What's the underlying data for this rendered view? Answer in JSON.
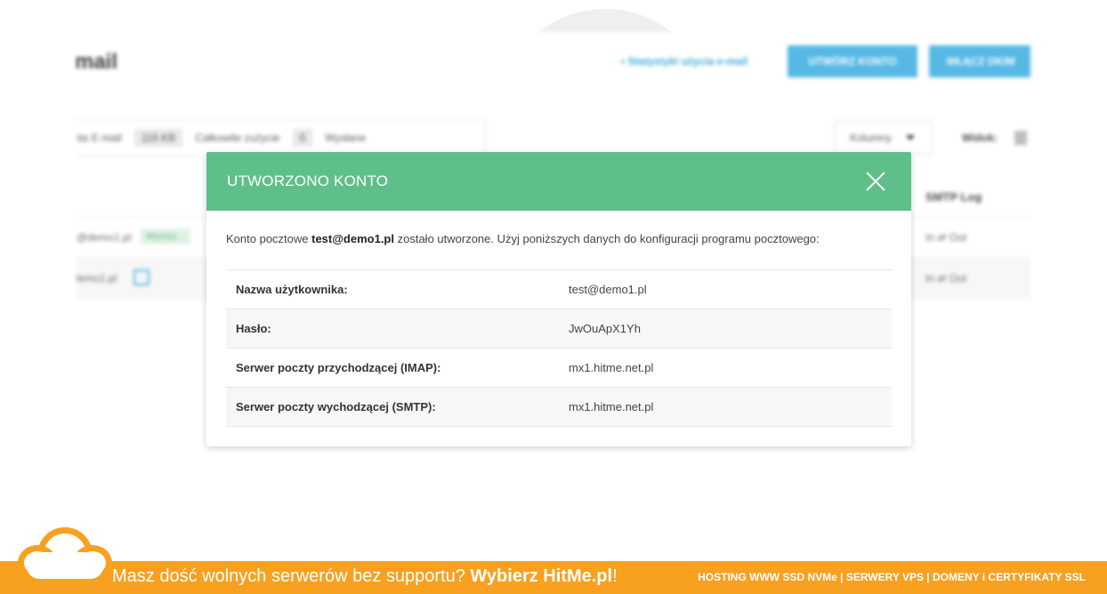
{
  "background_app": {
    "page_title": "-mail",
    "stats_link": "• Statystyki użycia e-mail",
    "create_button": "UTWÓRZ KONTO",
    "dkim_button": "WŁĄCZ DKIM",
    "summary_accounts_label": "onta E-mail",
    "summary_usage_value": "116 KB",
    "summary_usage_label": "Całkowite zużycie",
    "summary_sent_value": "0",
    "summary_sent_label": "Wysłane",
    "columns_select": "Kolumny",
    "view_label": "Widok:",
    "smtp_log_header": "SMTP Log",
    "rows": [
      {
        "email": "@demo1.pl",
        "badge": "Wycisz...",
        "smtp": "In ⇄ Out"
      },
      {
        "email": "lemo1.pl",
        "smtp": "In ⇄ Out"
      }
    ]
  },
  "modal": {
    "title": "UTWORZONO KONTO",
    "intro_prefix": "Konto pocztowe ",
    "intro_email": "test@demo1.pl",
    "intro_suffix": " zostało utworzone. Użyj poniższych danych do konfiguracji programu pocztowego:",
    "rows": [
      {
        "label": "Nazwa użytkownika:",
        "value": "test@demo1.pl"
      },
      {
        "label": "Hasło:",
        "value": "JwOuApX1Yh"
      },
      {
        "label": "Serwer poczty przychodzącej (IMAP):",
        "value": "mx1.hitme.net.pl"
      },
      {
        "label": "Serwer poczty wychodzącej (SMTP):",
        "value": "mx1.hitme.net.pl"
      }
    ]
  },
  "banner": {
    "message_prefix": "Masz dość wolnych serwerów bez supportu? ",
    "message_brand": "Wybierz HitMe.pl",
    "message_suffix": "!",
    "services": "HOSTING WWW SSD NVMe | SERWERY VPS | DOMENY i CERTYFIKATY SSL"
  },
  "colors": {
    "modal_header": "#5fbf8a",
    "accent_blue": "#4db5e3",
    "banner_orange": "#f8a020"
  },
  "icons": {
    "close": "close-icon",
    "caret": "caret-down-icon",
    "login": "login-icon",
    "view": "grid-view-icon",
    "cloud": "cloud-logo-icon"
  }
}
